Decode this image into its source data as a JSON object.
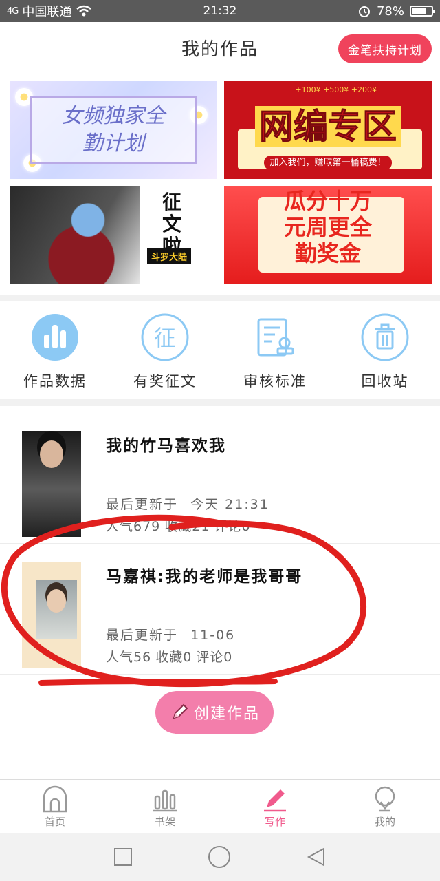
{
  "status_bar": {
    "carrier": "中国联通",
    "signal": "4G",
    "time": "21:32",
    "battery": "78%",
    "battery_level": 0.78
  },
  "header": {
    "title": "我的作品",
    "plan_button": "金笔扶持计划"
  },
  "banners": [
    {
      "title": "女频独家全勤计划"
    },
    {
      "title": "网编专区",
      "subtitle": "加入我们，赚取第一桶稿费！",
      "coins": "+100¥  +500¥  +200¥"
    },
    {
      "title": "征文啦",
      "tag": "斗罗大陆"
    },
    {
      "title": "瓜分十万元周更全勤奖金"
    }
  ],
  "quick_entries": [
    {
      "label": "作品数据",
      "icon": "bar-chart-icon"
    },
    {
      "label": "有奖征文",
      "icon": "contest-icon"
    },
    {
      "label": "审核标准",
      "icon": "review-standard-icon"
    },
    {
      "label": "回收站",
      "icon": "trash-icon"
    }
  ],
  "works": [
    {
      "title": "我的竹马喜欢我",
      "updated_label": "最后更新于",
      "updated_time": "今天 21:31",
      "popularity": "人气679",
      "favorites": "收藏21",
      "comments": "评论0"
    },
    {
      "title": "马嘉祺:我的老师是我哥哥",
      "updated_label": "最后更新于",
      "updated_time": "11-06",
      "popularity": "人气56",
      "favorites": "收藏0",
      "comments": "评论0"
    }
  ],
  "create_button": "创建作品",
  "tabs": [
    {
      "label": "首页",
      "icon": "home-icon"
    },
    {
      "label": "书架",
      "icon": "bookshelf-icon"
    },
    {
      "label": "写作",
      "icon": "pen-icon",
      "active": true
    },
    {
      "label": "我的",
      "icon": "profile-icon"
    }
  ],
  "colors": {
    "accent": "#f0435c",
    "pink": "#f37eab",
    "icon_blue": "#5cb3f0",
    "annotation_red": "#e0201e"
  }
}
